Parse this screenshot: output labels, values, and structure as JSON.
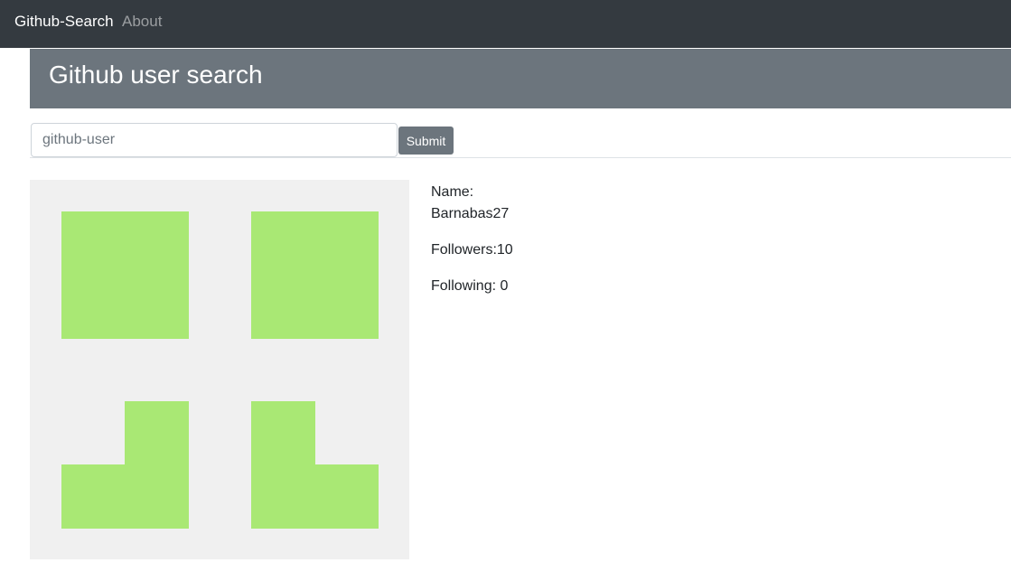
{
  "navbar": {
    "brand": "Github-Search",
    "links": [
      "About"
    ]
  },
  "header": {
    "title": "Github user search"
  },
  "search": {
    "placeholder": "github-user",
    "value": "",
    "submit_label": "Submit"
  },
  "profile": {
    "name_label": "Name:",
    "name_value": "Barnabas27",
    "followers_label": "Followers:",
    "followers_value": "10",
    "following_label": "Following: ",
    "following_value": "0"
  },
  "colors": {
    "navbar_bg": "#343a40",
    "header_bg": "#6c757d",
    "avatar_bg": "#f0f0f0",
    "avatar_fg": "#a9e874"
  }
}
